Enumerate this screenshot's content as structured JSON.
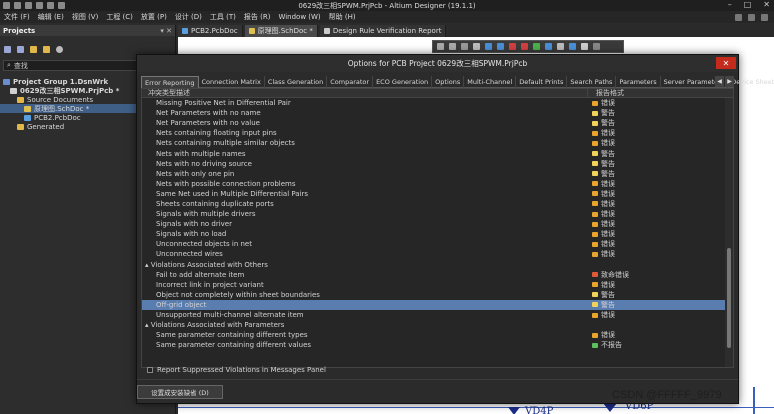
{
  "window": {
    "title": "0629改三相SPWM.PrjPcb - Altium Designer (19.1.1)"
  },
  "menu": [
    "文件 (F)",
    "编辑 (E)",
    "视图 (V)",
    "工程 (C)",
    "放置 (P)",
    "设计 (D)",
    "工具 (T)",
    "报告 (R)",
    "Window (W)",
    "帮助 (H)"
  ],
  "projects_panel": {
    "title": "Projects",
    "controls": "▾ ✕",
    "search_placeholder": "查找",
    "tree": [
      {
        "label": "Project Group 1.DsnWrk",
        "indent": 0,
        "icon": "workspace",
        "bold": true,
        "selected": false
      },
      {
        "label": "0629改三相SPWM.PrjPcb *",
        "indent": 1,
        "icon": "project",
        "bold": true,
        "selected": false
      },
      {
        "label": "Source Documents",
        "indent": 2,
        "icon": "folder",
        "bold": false,
        "selected": false
      },
      {
        "label": "原理图.SchDoc *",
        "indent": 3,
        "icon": "sch",
        "bold": false,
        "selected": true
      },
      {
        "label": "PCB2.PcbDoc",
        "indent": 3,
        "icon": "pcb",
        "bold": false,
        "selected": false
      },
      {
        "label": "Generated",
        "indent": 2,
        "icon": "folder",
        "bold": false,
        "selected": false
      }
    ]
  },
  "doc_tabs": [
    {
      "label": "PCB2.PcbDoc",
      "active": false,
      "icon_color": "#5aa0e0"
    },
    {
      "label": "原理图.SchDoc *",
      "active": true,
      "icon_color": "#e0c050"
    },
    {
      "label": "Design Rule Verification Report",
      "active": false,
      "icon_color": "#cccccc"
    }
  ],
  "canvas": {
    "labels": [
      "VD4P",
      "VD6P"
    ]
  },
  "dialog": {
    "title": "Options for PCB Project 0629改三相SPWM.PrjPcb",
    "close": "✕",
    "tabs": [
      {
        "label": "Error Reporting",
        "active": true
      },
      {
        "label": "Connection Matrix",
        "active": false
      },
      {
        "label": "Class Generation",
        "active": false
      },
      {
        "label": "Comparator",
        "active": false
      },
      {
        "label": "ECO Generation",
        "active": false
      },
      {
        "label": "Options",
        "active": false
      },
      {
        "label": "Multi-Channel",
        "active": false
      },
      {
        "label": "Default Prints",
        "active": false
      },
      {
        "label": "Search Paths",
        "active": false
      },
      {
        "label": "Parameters",
        "active": false
      },
      {
        "label": "Server Parameters",
        "active": false
      },
      {
        "label": "Device Sheets",
        "active": false
      }
    ],
    "tab_arrows": [
      "◀",
      "▶"
    ],
    "columns": {
      "violation": "冲突类型描述",
      "report": "报告格式"
    },
    "rows": [
      {
        "type": "item",
        "label": "Missing Positive Net in Differential Pair",
        "report": "错误",
        "color": "#e8a42c"
      },
      {
        "type": "item",
        "label": "Net Parameters with no name",
        "report": "警告",
        "color": "#f2d35a"
      },
      {
        "type": "item",
        "label": "Net Parameters with no value",
        "report": "警告",
        "color": "#f2d35a"
      },
      {
        "type": "item",
        "label": "Nets containing floating input pins",
        "report": "错误",
        "color": "#e8a42c"
      },
      {
        "type": "item",
        "label": "Nets containing multiple similar objects",
        "report": "错误",
        "color": "#e8a42c"
      },
      {
        "type": "item",
        "label": "Nets with multiple names",
        "report": "警告",
        "color": "#f2d35a"
      },
      {
        "type": "item",
        "label": "Nets with no driving source",
        "report": "警告",
        "color": "#f2d35a"
      },
      {
        "type": "item",
        "label": "Nets with only one pin",
        "report": "警告",
        "color": "#f2d35a"
      },
      {
        "type": "item",
        "label": "Nets with possible connection problems",
        "report": "错误",
        "color": "#e8a42c"
      },
      {
        "type": "item",
        "label": "Same Net used in Multiple Differential Pairs",
        "report": "错误",
        "color": "#e8a42c"
      },
      {
        "type": "item",
        "label": "Sheets containing duplicate ports",
        "report": "错误",
        "color": "#e8a42c"
      },
      {
        "type": "item",
        "label": "Signals with multiple drivers",
        "report": "错误",
        "color": "#e8a42c"
      },
      {
        "type": "item",
        "label": "Signals with no driver",
        "report": "错误",
        "color": "#e8a42c"
      },
      {
        "type": "item",
        "label": "Signals with no load",
        "report": "错误",
        "color": "#e8a42c"
      },
      {
        "type": "item",
        "label": "Unconnected objects in net",
        "report": "错误",
        "color": "#e8a42c"
      },
      {
        "type": "item",
        "label": "Unconnected wires",
        "report": "错误",
        "color": "#e8a42c"
      },
      {
        "type": "group",
        "label": "Violations Associated with Others",
        "report": "",
        "color": ""
      },
      {
        "type": "item",
        "label": "Fail to add alternate item",
        "report": "致命错误",
        "color": "#e05a3a"
      },
      {
        "type": "item",
        "label": "Incorrect link in project variant",
        "report": "错误",
        "color": "#e8a42c"
      },
      {
        "type": "item",
        "label": "Object not completely within sheet boundaries",
        "report": "警告",
        "color": "#f2d35a"
      },
      {
        "type": "item",
        "label": "Off-grid object",
        "report": "警告",
        "color": "#f2d35a",
        "selected": true
      },
      {
        "type": "item",
        "label": "Unsupported multi-channel alternate item",
        "report": "错误",
        "color": "#e8a42c"
      },
      {
        "type": "group",
        "label": "Violations Associated with Parameters",
        "report": "",
        "color": ""
      },
      {
        "type": "item",
        "label": "Same parameter containing different types",
        "report": "错误",
        "color": "#e8a42c"
      },
      {
        "type": "item",
        "label": "Same parameter containing different values",
        "report": "不报告",
        "color": "#5fbf5f"
      }
    ],
    "checkbox_label": "Report Suppressed Violations in Messages Panel",
    "default_button": "设置成安装缺省 (D)"
  },
  "watermark": "CSDN @FFFFF_9979"
}
